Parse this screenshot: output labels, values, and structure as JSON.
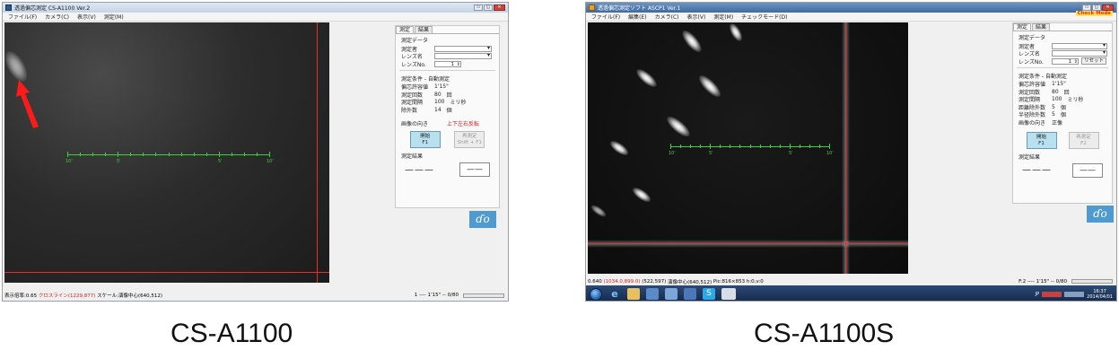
{
  "left": {
    "title": "透過偏芯測定 CS-A1100 Ver.2",
    "window_buttons": [
      "▭",
      "◱",
      "✕"
    ],
    "menu": [
      "ファイル(F)",
      "カメラ(C)",
      "表示(V)",
      "測定(M)"
    ],
    "scale_labels": [
      "10'",
      "5'",
      "5'",
      "10'"
    ],
    "panel": {
      "tabs": [
        "測定",
        "結果"
      ],
      "data_title": "測定データ",
      "operator_label": "測定者",
      "lens_name_label": "レンズ名",
      "lens_no_label": "レンズNo.",
      "lens_no_value": "1",
      "cond_title": "測定条件 - 自動測定",
      "tolerance_label": "偏芯許容値",
      "tolerance_value": "1'15\"",
      "count_label": "測定回数",
      "count_value": "80",
      "count_unit": "回",
      "interval_label": "測定間隔",
      "interval_value": "100",
      "interval_unit": "ミリ秒",
      "excl_label": "除外数",
      "excl_value": "14",
      "excl_unit": "個",
      "orient_label": "画像の向き",
      "orient_value": "上下左右反転",
      "start_label": "開始",
      "start_key": "F1",
      "remeasure_label": "再測定",
      "remeasure_key": "Shift + F1",
      "result_title": "測定結果",
      "result_dashes": "———",
      "result_box": "——"
    },
    "status": {
      "display_ratio": "表示倍率:0.65",
      "crossline": "クロスライン(1229,877)",
      "scale_center": "スケール:演像中心(640,512)",
      "right": "1 ---- 1'15\" -- 0/80"
    },
    "caption": "CS-A1100"
  },
  "right": {
    "title": "透過偏芯測定ソフト ASCP1 Ver.1",
    "mode_badge": "Check Mode",
    "window_buttons": [
      "▭",
      "◱",
      "✕"
    ],
    "menu": [
      "ファイル(F)",
      "編集(E)",
      "カメラ(C)",
      "表示(V)",
      "測定(M)",
      "チェックモード(D)"
    ],
    "scale_labels": [
      "10'",
      "5'",
      "5'",
      "10'"
    ],
    "panel": {
      "tabs": [
        "測定",
        "結果"
      ],
      "data_title": "測定データ",
      "operator_label": "測定者",
      "lens_name_label": "レンズ名",
      "lens_no_label": "レンズNo.",
      "lens_no_value": "1",
      "reset_label": "リセット",
      "cond_title": "測定条件 - 自動測定",
      "tolerance_label": "偏芯許容値",
      "tolerance_value": "1'15\"",
      "count_label": "測定回数",
      "count_value": "80",
      "count_unit": "回",
      "interval_label": "測定間隔",
      "interval_value": "100",
      "interval_unit": "ミリ秒",
      "dist_excl_label": "距離除外数",
      "dist_excl_value": "5",
      "dist_excl_unit": "個",
      "rad_excl_label": "半径除外数",
      "rad_excl_value": "5",
      "rad_excl_unit": "個",
      "orient_label": "画像の向き",
      "orient_value": "正像",
      "start_label": "開始",
      "start_key": "F1",
      "remeasure_label": "再測定",
      "remeasure_key": "F2",
      "result_title": "測定結果",
      "result_dashes": "———",
      "result_box": "——"
    },
    "status": {
      "ratio": "0.640",
      "cross": "(1034.0,899.0)",
      "coords": "(522,597)",
      "center": "演像中心(640,512)",
      "pic": "Pic:816×853",
      "h": "h:0,v:0",
      "right": "F:2 ---- 1'15\" -- 0/80"
    },
    "taskbar": {
      "tray_text": "JP",
      "time": "16:37",
      "date": "2014/04/01"
    },
    "caption": "CS-A1100S"
  },
  "colors": {
    "crosshair": "#e03030",
    "scale": "#3ecf3e",
    "start_button": "#b8e0ee",
    "logo": "#4f9ad0",
    "status_red": "#d02020"
  }
}
